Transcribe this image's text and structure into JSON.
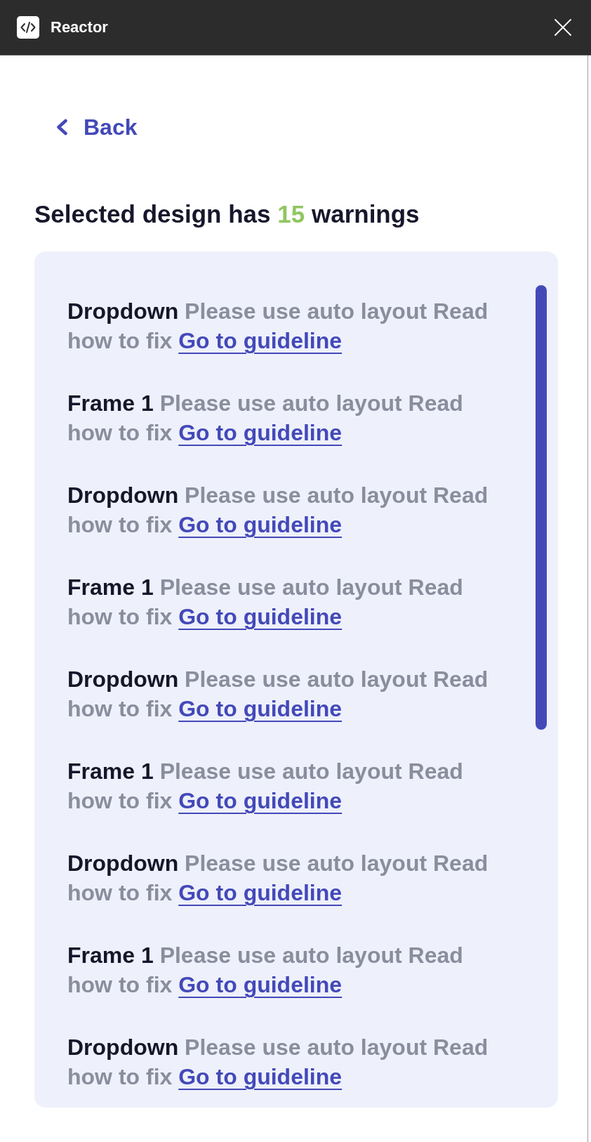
{
  "window": {
    "title": "Reactor"
  },
  "back_button": {
    "label": "Back"
  },
  "summary": {
    "prefix": "Selected design has",
    "count": "15",
    "suffix": "warnings"
  },
  "warnings": [
    {
      "layer": "Dropdown",
      "message": "Please use auto layout Read how to fix",
      "link": "Go to guideline"
    },
    {
      "layer": "Frame 1",
      "message": "Please use auto layout Read how to fix",
      "link": "Go to guideline"
    },
    {
      "layer": "Dropdown",
      "message": "Please use auto layout Read how to fix",
      "link": "Go to guideline"
    },
    {
      "layer": "Frame 1",
      "message": "Please use auto layout Read how to fix",
      "link": "Go to guideline"
    },
    {
      "layer": "Dropdown",
      "message": "Please use auto layout Read how to fix",
      "link": "Go to guideline"
    },
    {
      "layer": "Frame 1",
      "message": "Please use auto layout Read how to fix",
      "link": "Go to guideline"
    },
    {
      "layer": "Dropdown",
      "message": "Please use auto layout Read how to fix",
      "link": "Go to guideline"
    },
    {
      "layer": "Frame 1",
      "message": "Please use auto layout Read how to fix",
      "link": "Go to guideline"
    },
    {
      "layer": "Dropdown",
      "message": "Please use auto layout Read how to fix",
      "link": "Go to guideline"
    }
  ]
}
